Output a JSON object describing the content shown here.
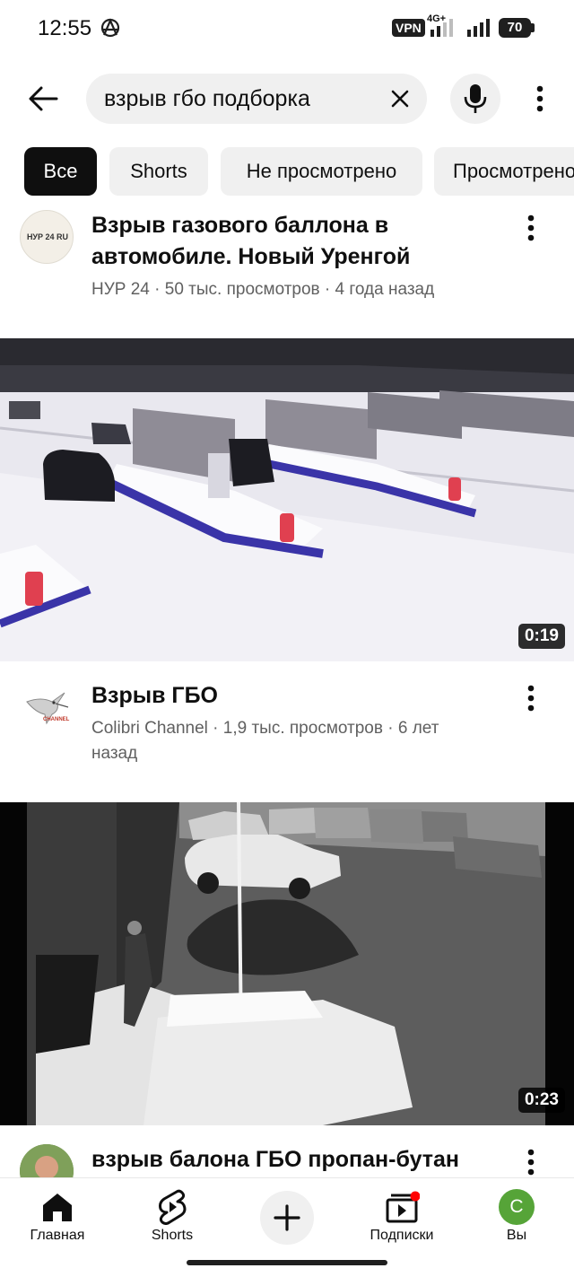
{
  "status_bar": {
    "time": "12:55",
    "vpn": "VPN",
    "network": "4G+",
    "battery": "70"
  },
  "search": {
    "query": "взрыв гбо подборка"
  },
  "chips": [
    {
      "label": "Все",
      "active": true
    },
    {
      "label": "Shorts",
      "active": false
    },
    {
      "label": "Не просмотрено",
      "active": false
    },
    {
      "label": "Просмотрено",
      "active": false
    }
  ],
  "videos": [
    {
      "title": "Взрыв газового баллона в автомобиле. Новый Уренгой",
      "meta": "НУР 24 · 50 тыс. просмотров · 4 года назад",
      "avatar_text": "НУР 24 RU",
      "duration": "0:19"
    },
    {
      "title": "Взрыв ГБО",
      "meta": "Colibri Channel · 1,9 тыс. просмотров · 6 лет назад",
      "avatar_text": "CHANNEL",
      "duration": "0:23"
    },
    {
      "title": "взрыв балона ГБО пропан-бутан"
    }
  ],
  "bottom_nav": {
    "home": "Главная",
    "shorts": "Shorts",
    "subscriptions": "Подписки",
    "you": "Вы",
    "you_avatar_letter": "C"
  },
  "colors": {
    "accent_red": "#ff0000",
    "you_avatar": "#56a438",
    "chip_active": "#0f0f0f",
    "chip_bg": "#f0f0f0"
  }
}
